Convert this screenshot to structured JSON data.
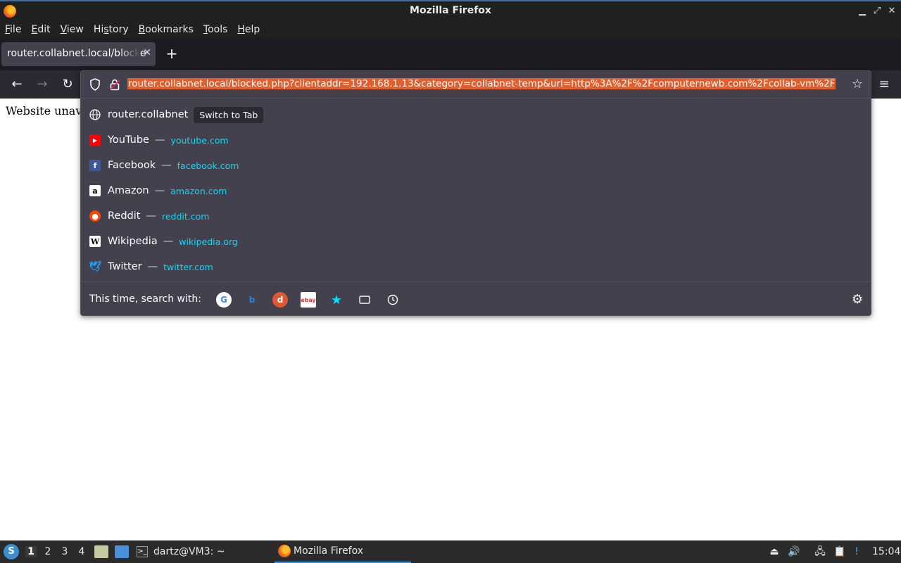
{
  "window": {
    "title": "Mozilla Firefox"
  },
  "menubar": {
    "items": [
      {
        "label": "File",
        "accel": "F",
        "rest": "ile"
      },
      {
        "label": "Edit",
        "accel": "E",
        "rest": "dit"
      },
      {
        "label": "View",
        "accel": "V",
        "rest": "iew"
      },
      {
        "label": "History",
        "pre": "Hi",
        "accel": "s",
        "rest": "tory"
      },
      {
        "label": "Bookmarks",
        "accel": "B",
        "rest": "ookmarks"
      },
      {
        "label": "Tools",
        "accel": "T",
        "rest": "ools"
      },
      {
        "label": "Help",
        "accel": "H",
        "rest": "elp"
      }
    ]
  },
  "tabs": [
    {
      "label": "router.collabnet.local/blocke"
    }
  ],
  "urlbar": {
    "value": "router.collabnet.local/blocked.php?clientaddr=192.168.1.13&category=collabnet-temp&url=http%3A%2F%2Fcomputernewb.com%2Fcollab-vm%2F"
  },
  "page": {
    "text": "Website unav"
  },
  "suggestions": {
    "first": {
      "title": "router.collabnet",
      "action": "Switch to Tab"
    },
    "sites": [
      {
        "title": "YouTube",
        "url": "youtube.com",
        "icon": "youtube-icon",
        "color": "#ff0000"
      },
      {
        "title": "Facebook",
        "url": "facebook.com",
        "icon": "facebook-icon",
        "color": "#3b5998"
      },
      {
        "title": "Amazon",
        "url": "amazon.com",
        "icon": "amazon-icon",
        "color": "#ffffff"
      },
      {
        "title": "Reddit",
        "url": "reddit.com",
        "icon": "reddit-icon",
        "color": "#ff4500"
      },
      {
        "title": "Wikipedia",
        "url": "wikipedia.org",
        "icon": "wikipedia-icon",
        "color": "#ffffff"
      },
      {
        "title": "Twitter",
        "url": "twitter.com",
        "icon": "twitter-icon",
        "color": "#1da1f2"
      }
    ],
    "separator": "—"
  },
  "search_with": {
    "label": "This time, search with:",
    "engines": [
      "google-icon",
      "bing-icon",
      "duckduckgo-icon",
      "ebay-icon",
      "bookmarks-icon",
      "tabs-icon",
      "history-icon"
    ]
  },
  "taskbar": {
    "workspaces": [
      "1",
      "2",
      "3",
      "4"
    ],
    "active_workspace": "1",
    "terminal_task": "dartz@VM3: ~",
    "firefox_task": "Mozilla Firefox",
    "clock": "15:04"
  },
  "colors": {
    "url_highlight": "#e35e2a",
    "link": "#00ddff",
    "panel": "#42414d"
  }
}
